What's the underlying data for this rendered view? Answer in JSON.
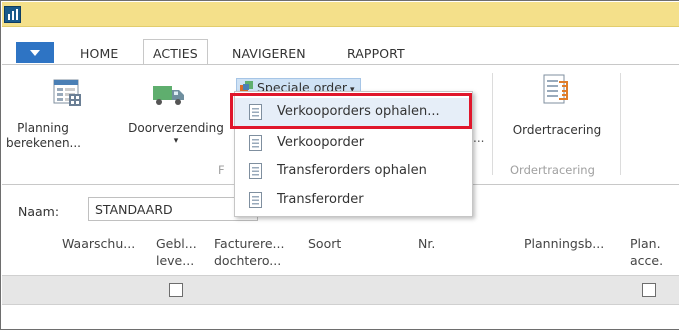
{
  "ribbon": {
    "tabs": [
      {
        "label": "HOME"
      },
      {
        "label": "ACTIES"
      },
      {
        "label": "NAVIGEREN"
      },
      {
        "label": "RAPPORT"
      }
    ],
    "active_tab": "ACTIES",
    "buttons": {
      "planning": {
        "line1": "Planning",
        "line2": "berekenen..."
      },
      "doorverzending": {
        "label": "Doorverzending",
        "caret": "▾"
      },
      "special_order": {
        "label": "Speciale order",
        "caret": "▾"
      },
      "ordertracering": {
        "label": "Ordertracering"
      }
    },
    "group_labels": {
      "functions_partial": "F",
      "ordertracering": "Ordertracering"
    },
    "partial_ellipsis": "..."
  },
  "dropdown": {
    "items": [
      {
        "label": "Verkooporders ophalen..."
      },
      {
        "label": "Verkooporder"
      },
      {
        "label": "Transferorders ophalen"
      },
      {
        "label": "Transferorder"
      }
    ]
  },
  "filter": {
    "name_label": "Naam:",
    "name_value": "STANDAARD"
  },
  "grid": {
    "columns": [
      {
        "line1": "Waarschu...",
        "line2": ""
      },
      {
        "line1": "Gebl...",
        "line2": "leve..."
      },
      {
        "line1": "Facturere...",
        "line2": "dochtero..."
      },
      {
        "line1": "Soort",
        "line2": ""
      },
      {
        "line1": "Nr.",
        "line2": ""
      },
      {
        "line1": "Planningsb...",
        "line2": ""
      },
      {
        "line1": "Plan.",
        "line2": "acce."
      }
    ],
    "rows": [
      {
        "gebl_leve_checked": false,
        "plan_acce_checked": false
      }
    ]
  },
  "colors": {
    "titlebar": "#f4e08a",
    "app_menu": "#2e74c4",
    "highlight_border": "#e0162b",
    "special_order_bg": "#cfe2f5",
    "row_bg": "#e6e6e6"
  },
  "icons": {
    "app": "nav-app-icon",
    "planning": "planning-worksheet-icon",
    "doorverzending": "truck-icon",
    "special_order": "special-order-icon",
    "ordertracering": "order-tracking-icon",
    "menu_item": "document-icon"
  }
}
